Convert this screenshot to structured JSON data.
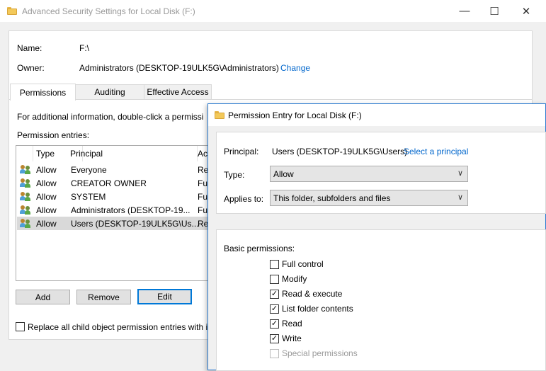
{
  "window": {
    "title": "Advanced Security Settings for Local Disk (F:)",
    "minimize_glyph": "—",
    "maximize_glyph": "☐",
    "close_glyph": "✕"
  },
  "details": {
    "name_label": "Name:",
    "name_value": "F:\\",
    "owner_label": "Owner:",
    "owner_value": "Administrators (DESKTOP-19ULK5G\\Administrators)",
    "change_link": "Change"
  },
  "tabs": [
    {
      "label": "Permissions",
      "active": true
    },
    {
      "label": "Auditing",
      "active": false
    },
    {
      "label": "Effective Access",
      "active": false
    }
  ],
  "permissions_tab": {
    "info_text": "For additional information, double-click a permissi",
    "entries_label": "Permission entries:",
    "columns": [
      "Type",
      "Principal",
      "Ac"
    ],
    "rows": [
      {
        "type": "Allow",
        "principal": "Everyone",
        "access": "Re"
      },
      {
        "type": "Allow",
        "principal": "CREATOR OWNER",
        "access": "Fu"
      },
      {
        "type": "Allow",
        "principal": "SYSTEM",
        "access": "Fu"
      },
      {
        "type": "Allow",
        "principal": "Administrators (DESKTOP-19...",
        "access": "Fu"
      },
      {
        "type": "Allow",
        "principal": "Users (DESKTOP-19ULK5G\\Us...",
        "access": "Re"
      }
    ],
    "selected_row": 4,
    "add_label": "Add",
    "remove_label": "Remove",
    "edit_label": "Edit",
    "replace_label": "Replace all child object permission entries with in",
    "replace_checked": false
  },
  "dialog": {
    "title": "Permission Entry for Local Disk (F:)",
    "principal_label": "Principal:",
    "principal_value": "Users (DESKTOP-19ULK5G\\Users)",
    "select_principal_link": "Select a principal",
    "type_label": "Type:",
    "type_value": "Allow",
    "applies_label": "Applies to:",
    "applies_value": "This folder, subfolders and files",
    "basic_label": "Basic permissions:",
    "permissions": [
      {
        "label": "Full control",
        "checked": false,
        "disabled": false
      },
      {
        "label": "Modify",
        "checked": false,
        "disabled": false
      },
      {
        "label": "Read & execute",
        "checked": true,
        "disabled": false
      },
      {
        "label": "List folder contents",
        "checked": true,
        "disabled": false
      },
      {
        "label": "Read",
        "checked": true,
        "disabled": false
      },
      {
        "label": "Write",
        "checked": true,
        "disabled": false
      },
      {
        "label": "Special permissions",
        "checked": false,
        "disabled": true
      }
    ]
  },
  "colors": {
    "accent": "#0078d7",
    "link": "#0066cc",
    "selected_row": "#d9d9d9"
  }
}
